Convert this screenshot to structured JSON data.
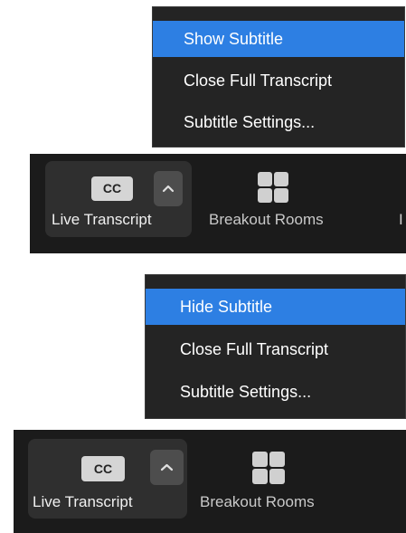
{
  "top": {
    "menu": [
      {
        "label": "Show Subtitle",
        "active": true
      },
      {
        "label": "Close Full Transcript",
        "active": false
      },
      {
        "label": "Subtitle Settings...",
        "active": false
      }
    ],
    "toolbar": {
      "cc_icon_text": "CC",
      "live_label": "Live Transcript",
      "breakout_label": "Breakout Rooms",
      "edge_glyph": "I"
    }
  },
  "bottom": {
    "menu": [
      {
        "label": "Hide Subtitle",
        "active": true
      },
      {
        "label": "Close Full Transcript",
        "active": false
      },
      {
        "label": "Subtitle Settings...",
        "active": false
      }
    ],
    "toolbar": {
      "cc_icon_text": "CC",
      "live_label": "Live Transcript",
      "breakout_label": "Breakout Rooms"
    }
  },
  "icons": {
    "cc": "closed-caption-icon",
    "caret": "chevron-up-icon",
    "breakout": "grid-icon"
  },
  "colors": {
    "menu_bg": "#242424",
    "menu_active": "#2d7fe3",
    "toolbar_bg": "#1b1b1b",
    "button_bg": "#2f2f2f"
  }
}
